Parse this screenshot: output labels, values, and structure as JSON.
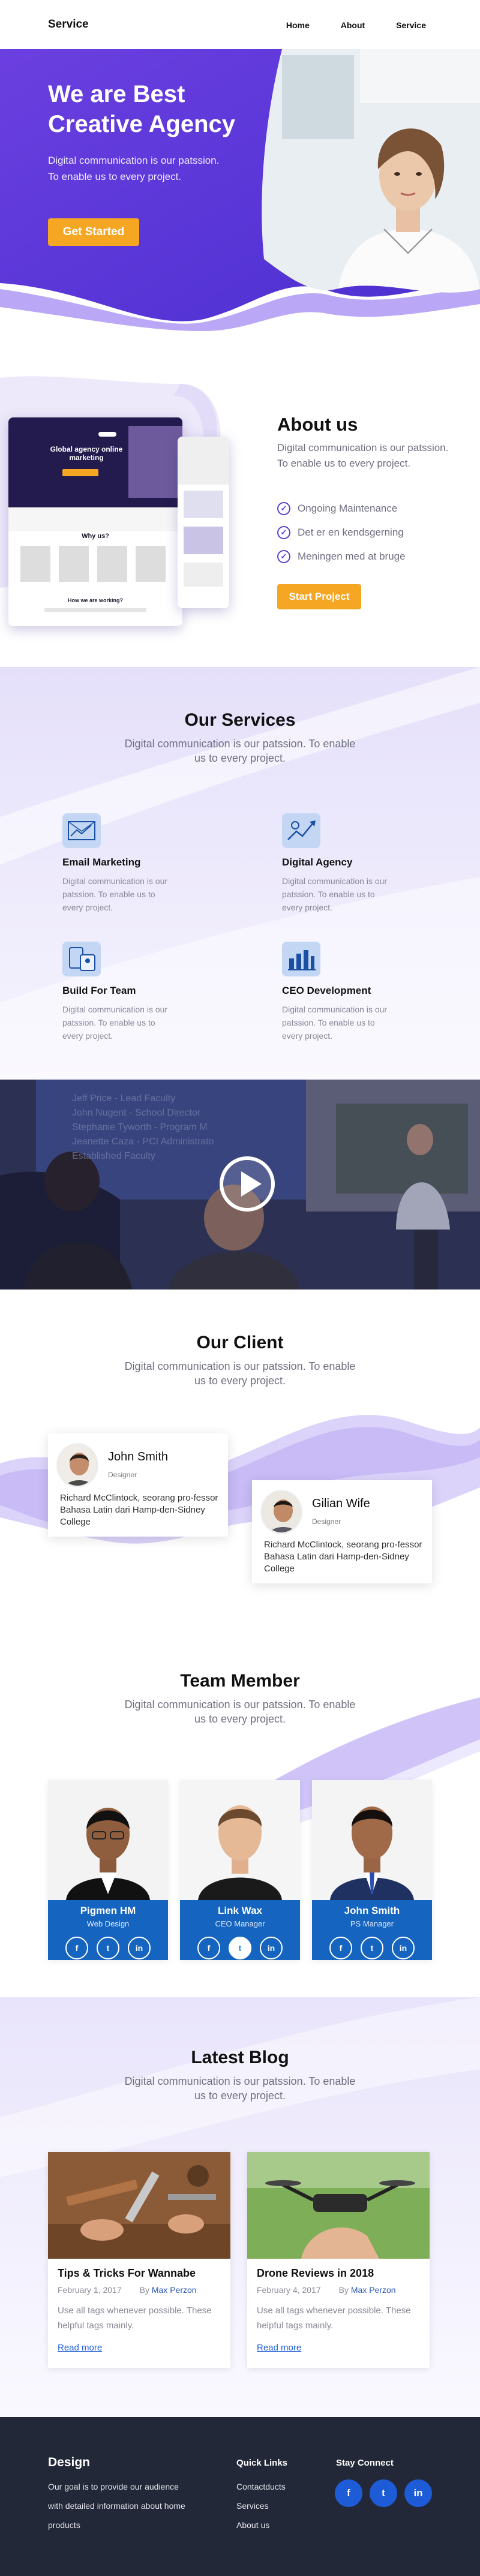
{
  "nav": {
    "brand": "Service",
    "items": [
      {
        "label": "Home"
      },
      {
        "label": "About"
      },
      {
        "label": "Service"
      }
    ]
  },
  "hero": {
    "title_line1": "We are Best",
    "title_line2": "Creative Agency",
    "subtitle": "Digital communication is our patssion. To enable us to every project.",
    "button": "Get Started"
  },
  "about": {
    "title": "About us",
    "subtitle": "Digital communication is our patssion. To enable us to every project.",
    "items": [
      {
        "label": "Ongoing Maintenance"
      },
      {
        "label": "Det er en kendsgerning"
      },
      {
        "label": "Meningen med at bruge"
      }
    ],
    "button": "Start Project",
    "mockup": {
      "headline": "Global agency online marketing",
      "why_heading": "Why us?",
      "how_heading": "How we are working?"
    }
  },
  "services": {
    "title": "Our Services",
    "subtitle": "Digital communication is our patssion. To enable us to every project.",
    "items": [
      {
        "name": "Email Marketing",
        "desc": "Digital communication is our patssion. To enable us to every project.",
        "icon": "email-chart-icon"
      },
      {
        "name": "Digital Agency",
        "desc": "Digital communication is our patssion. To enable us to every project.",
        "icon": "growth-icon"
      },
      {
        "name": "Build For Team",
        "desc": "Digital communication is our patssion. To enable us to every project.",
        "icon": "team-devices-icon"
      },
      {
        "name": "CEO Development",
        "desc": "Digital communication is our patssion. To enable us to every project.",
        "icon": "bar-chart-icon"
      }
    ]
  },
  "video": {
    "slide_lines": [
      "Jeff Price - Lead Faculty",
      "John Nugent - School Director",
      "Stephanie Tyworth - Program M",
      "Jeanette Caza - PCI Administrato",
      "Established Faculty"
    ]
  },
  "clients": {
    "title": "Our Client",
    "subtitle": "Digital communication is our patssion. To enable us to every project.",
    "items": [
      {
        "name": "John Smith",
        "role": "Designer",
        "text": "Richard McClintock, seorang pro-fessor Bahasa Latin dari Hamp-den-Sidney College"
      },
      {
        "name": "Gilian Wife",
        "role": "Designer",
        "text": "Richard McClintock, seorang pro-fessor Bahasa Latin dari Hamp-den-Sidney College"
      }
    ]
  },
  "team": {
    "title": "Team Member",
    "subtitle": "Digital communication is our patssion. To enable us to every project.",
    "members": [
      {
        "name": "Pigmen HM",
        "role": "Web Design",
        "photo": "man-glasses-portrait"
      },
      {
        "name": "Link Wax",
        "role": "CEO Manager",
        "photo": "man-portrait"
      },
      {
        "name": "John Smith",
        "role": "PS Manager",
        "photo": "man-suit-portrait"
      }
    ],
    "social_glyphs": {
      "facebook": "f",
      "twitter": "t",
      "linkedin": "in"
    }
  },
  "blog": {
    "title": "Latest Blog",
    "subtitle": "Digital communication is our patssion. To enable us to every project.",
    "posts": [
      {
        "title": "Tips & Tricks For Wannabe",
        "date": "February 1, 2017",
        "by": "By",
        "author": "Max Perzon",
        "desc": "Use all tags whenever possible. These helpful tags mainly.",
        "more": "Read more",
        "image": "workshop-tools-photo"
      },
      {
        "title": "Drone Reviews in 2018",
        "date": "February 4, 2017",
        "by": "By",
        "author": "Max Perzon",
        "desc": "Use all tags whenever possible. These helpful tags mainly.",
        "more": "Read more",
        "image": "drone-photo"
      }
    ]
  },
  "footer": {
    "brand": "Design",
    "desc": "Our goal is to provide our audience with detailed information about home products",
    "links_title": "Quick Links",
    "links": [
      "Contactducts",
      "Services",
      "About us"
    ],
    "connect_title": "Stay Connect",
    "social_glyphs": {
      "facebook": "f",
      "twitter": "t",
      "linkedin": "in"
    }
  },
  "colors": {
    "primary_purple": "#5b3fd6",
    "accent_orange": "#f5a623",
    "team_blue": "#1565c0",
    "footer_navy": "#222838"
  }
}
